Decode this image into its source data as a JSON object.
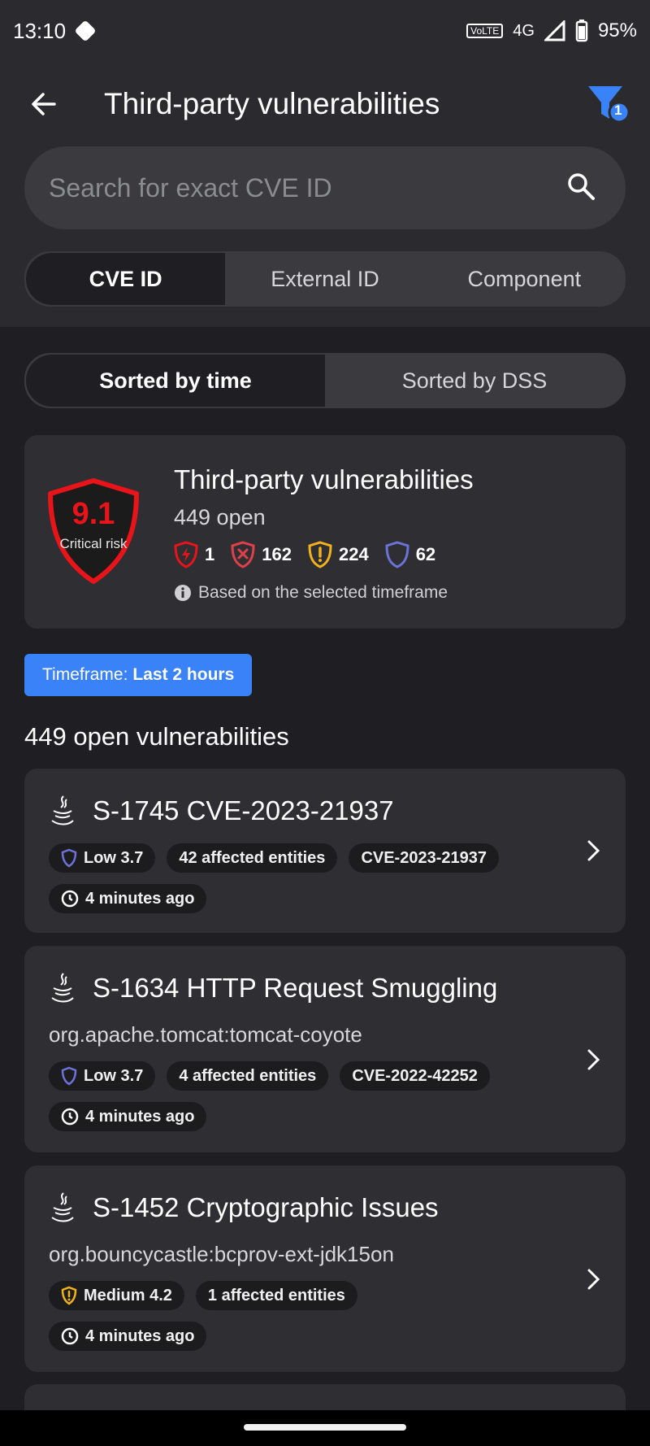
{
  "status_bar": {
    "time": "13:10",
    "network": "4G",
    "battery": "95%"
  },
  "app_bar": {
    "title": "Third-party vulnerabilities",
    "filter_count": "1"
  },
  "search": {
    "placeholder": "Search for exact CVE ID"
  },
  "search_tabs": [
    {
      "label": "CVE ID",
      "active": true
    },
    {
      "label": "External ID",
      "active": false
    },
    {
      "label": "Component",
      "active": false
    }
  ],
  "sort_tabs": [
    {
      "label": "Sorted by time",
      "active": true
    },
    {
      "label": "Sorted by DSS",
      "active": false
    }
  ],
  "summary": {
    "score": "9.1",
    "risk_label": "Critical risk",
    "title": "Third-party vulnerabilities",
    "open": "449 open",
    "counts": {
      "critical": "1",
      "high": "162",
      "medium": "224",
      "low": "62"
    },
    "note": "Based on the selected timeframe"
  },
  "timeframe": {
    "label": "Timeframe:",
    "value": "Last 2 hours"
  },
  "list_heading": "449 open vulnerabilities",
  "vulnerabilities": [
    {
      "title": "S-1745 CVE-2023-21937",
      "component": "",
      "severity": "Low 3.7",
      "entities": "42 affected entities",
      "cve": "CVE-2023-21937",
      "time": "4 minutes ago"
    },
    {
      "title": "S-1634 HTTP Request Smuggling",
      "component": "org.apache.tomcat:tomcat-coyote",
      "severity": "Low 3.7",
      "entities": "4 affected entities",
      "cve": "CVE-2022-42252",
      "time": "4 minutes ago"
    },
    {
      "title": "S-1452 Cryptographic Issues",
      "component": "org.bouncycastle:bcprov-ext-jdk15on",
      "severity": "Medium 4.2",
      "entities": "1 affected entities",
      "cve": "",
      "time": "4 minutes ago"
    }
  ],
  "colors": {
    "critical": "#e8141a",
    "high": "#e0404a",
    "medium": "#f2b21b",
    "low": "#6c72d8",
    "accent": "#3a82f7"
  }
}
